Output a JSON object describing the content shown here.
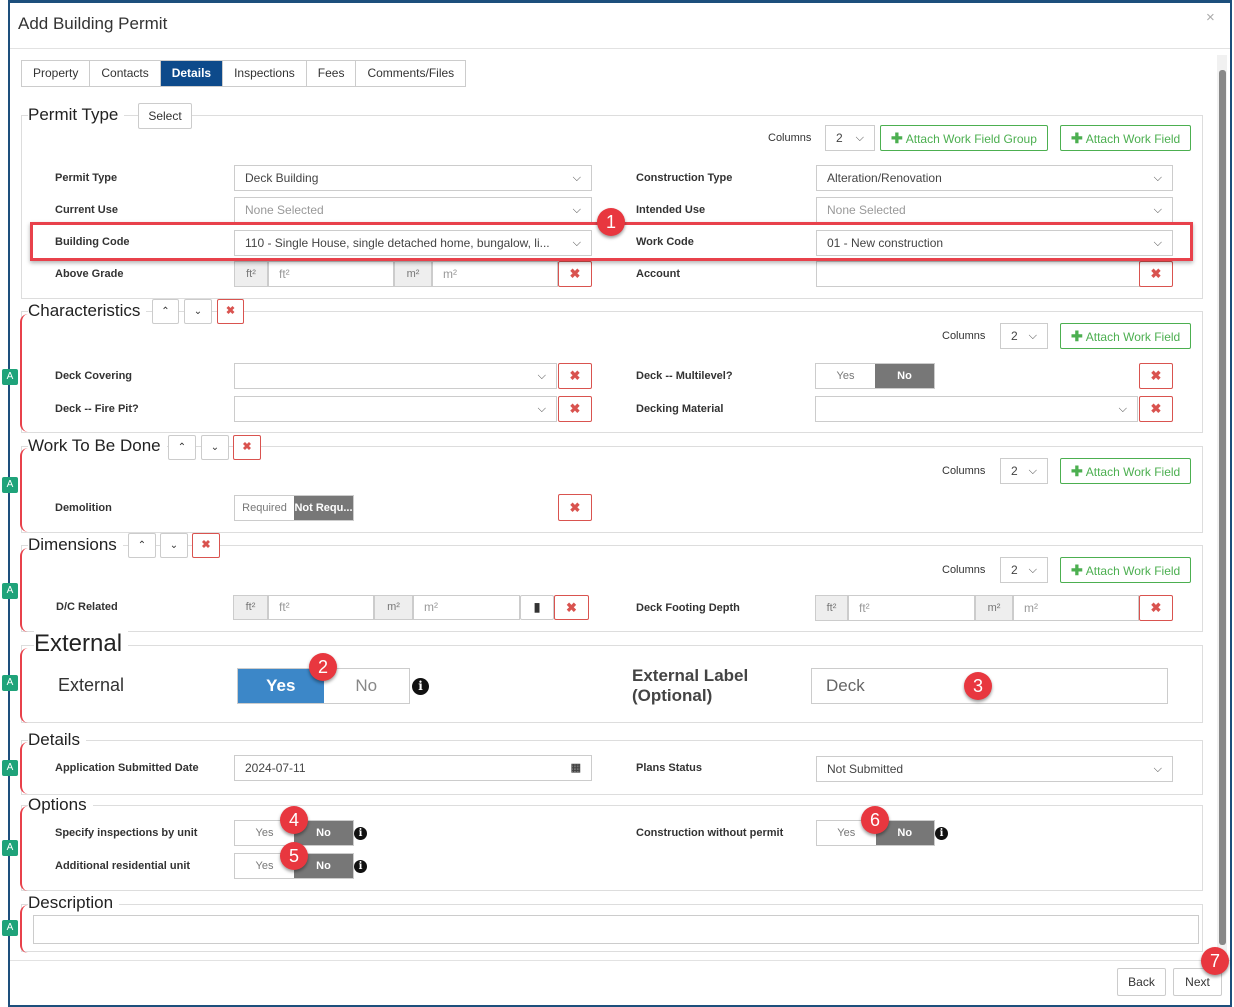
{
  "dialog": {
    "title": "Add Building Permit",
    "close": "×"
  },
  "tabs": [
    "Property",
    "Contacts",
    "Details",
    "Inspections",
    "Fees",
    "Comments/Files"
  ],
  "common": {
    "columns_label": "Columns",
    "columns_value": "2",
    "attach_group": "Attach Work Field Group",
    "attach_field": "Attach Work Field",
    "plus": "✚",
    "remove": "✖",
    "up": "⌃",
    "down": "⌄",
    "chevron": "⌵",
    "ft2": "ft²",
    "m2": "m²",
    "yes": "Yes",
    "no": "No"
  },
  "permit_type": {
    "legend": "Permit Type",
    "select": "Select",
    "permit_type_label": "Permit Type",
    "permit_type_value": "Deck Building",
    "current_use_label": "Current Use",
    "current_use_value": "None Selected",
    "building_code_label": "Building Code",
    "building_code_value": "110 - Single House, single detached home, bungalow, li...",
    "above_grade_label": "Above Grade",
    "construction_type_label": "Construction Type",
    "construction_type_value": "Alteration/Renovation",
    "intended_use_label": "Intended Use",
    "intended_use_value": "None Selected",
    "work_code_label": "Work Code",
    "work_code_value": "01 - New construction",
    "account_label": "Account"
  },
  "characteristics": {
    "legend": "Characteristics",
    "deck_covering": "Deck Covering",
    "fire_pit": "Deck -- Fire Pit?",
    "multilevel": "Deck -- Multilevel?",
    "decking_material": "Decking Material"
  },
  "work": {
    "legend": "Work To Be Done",
    "demolition": "Demolition",
    "required": "Required",
    "not_required": "Not Requ..."
  },
  "dimensions": {
    "legend": "Dimensions",
    "dc_related": "D/C Related",
    "footing": "Deck Footing Depth"
  },
  "external": {
    "legend": "External",
    "label": "External",
    "ext_label": "External Label (Optional)",
    "ext_value": "Deck"
  },
  "details": {
    "legend": "Details",
    "date_label": "Application Submitted Date",
    "date_value": "2024-07-11",
    "plans_label": "Plans Status",
    "plans_value": "Not Submitted"
  },
  "options": {
    "legend": "Options",
    "specify": "Specify inspections by unit",
    "additional": "Additional residential unit",
    "without": "Construction without permit"
  },
  "description": {
    "legend": "Description"
  },
  "footer": {
    "back": "Back",
    "next": "Next"
  },
  "callouts": [
    "1",
    "2",
    "3",
    "4",
    "5",
    "6",
    "7"
  ],
  "markers": {
    "a": "A"
  }
}
